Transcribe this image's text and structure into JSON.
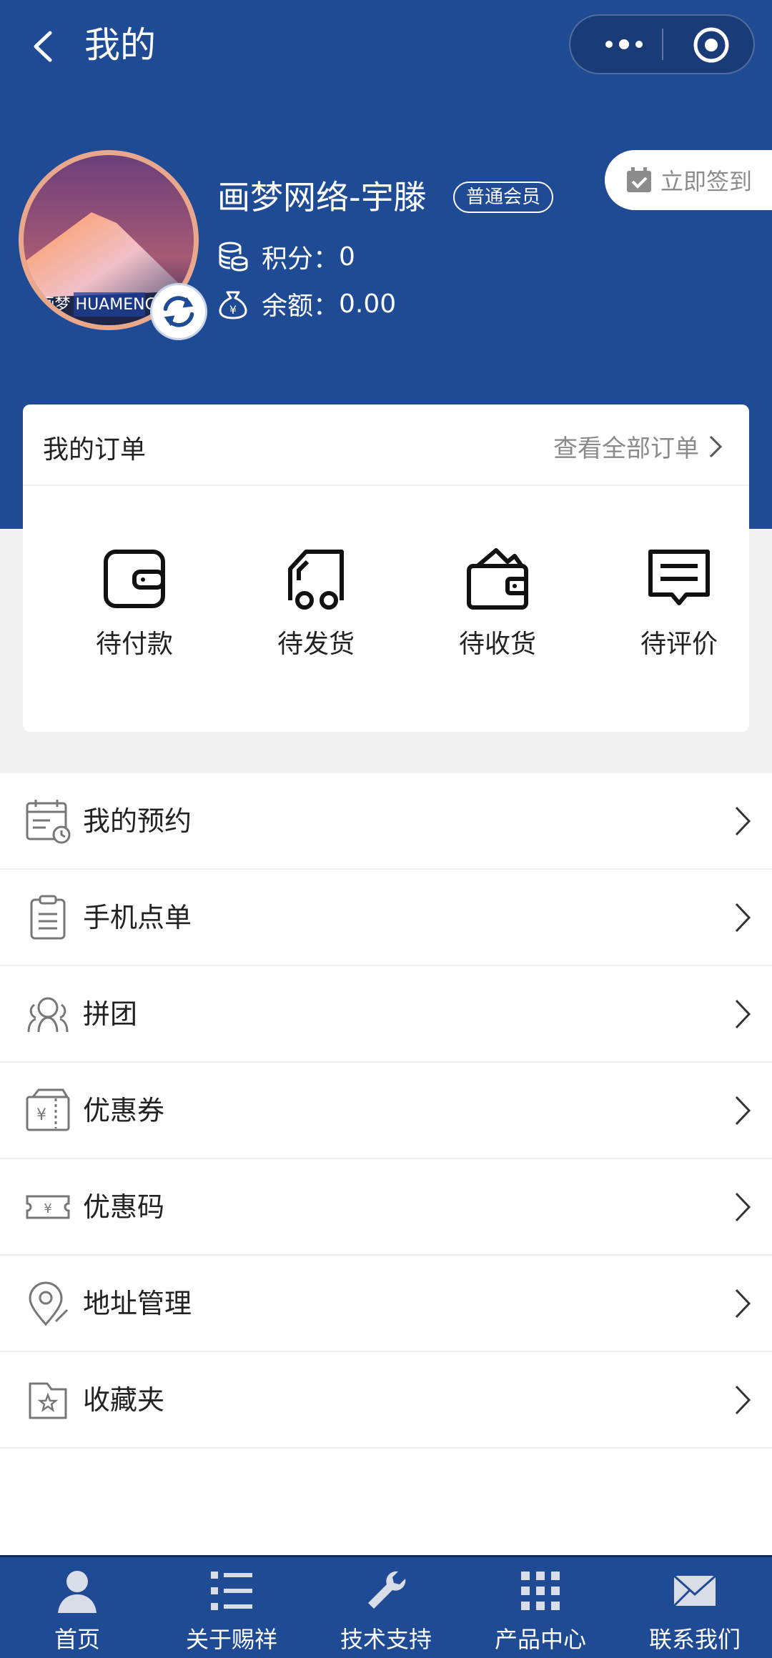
{
  "nav": {
    "title": "我的"
  },
  "profile": {
    "name": "画梦网络-宇滕",
    "member_level": "普通会员",
    "points_label": "积分：",
    "points_value": "0",
    "balance_label": "余额：",
    "balance_value": "0.00",
    "avatar_watermark": "画梦 HUAMENGCN"
  },
  "signin": {
    "label": "立即签到"
  },
  "orders": {
    "title": "我的订单",
    "view_all": "查看全部订单",
    "items": [
      {
        "label": "待付款",
        "icon": "wallet-icon"
      },
      {
        "label": "待发货",
        "icon": "truck-icon"
      },
      {
        "label": "待收货",
        "icon": "purse-icon"
      },
      {
        "label": "待评价",
        "icon": "comment-icon"
      }
    ]
  },
  "menu": [
    {
      "label": "我的预约",
      "icon": "calendar-clock-icon"
    },
    {
      "label": "手机点单",
      "icon": "clipboard-icon"
    },
    {
      "label": "拼团",
      "icon": "group-icon"
    },
    {
      "label": "优惠券",
      "icon": "coupon-icon"
    },
    {
      "label": "优惠码",
      "icon": "ticket-icon"
    },
    {
      "label": "地址管理",
      "icon": "location-pin-icon"
    },
    {
      "label": "收藏夹",
      "icon": "favorites-folder-icon"
    }
  ],
  "tabbar": [
    {
      "label": "首页",
      "icon": "user-icon"
    },
    {
      "label": "关于赐祥",
      "icon": "list-icon"
    },
    {
      "label": "技术支持",
      "icon": "wrench-icon"
    },
    {
      "label": "产品中心",
      "icon": "grid-icon"
    },
    {
      "label": "联系我们",
      "icon": "mail-icon"
    }
  ],
  "colors": {
    "brand": "#1f4a94",
    "background": "#f1f1f1",
    "text": "#222222",
    "muted": "#8a8a8a"
  }
}
